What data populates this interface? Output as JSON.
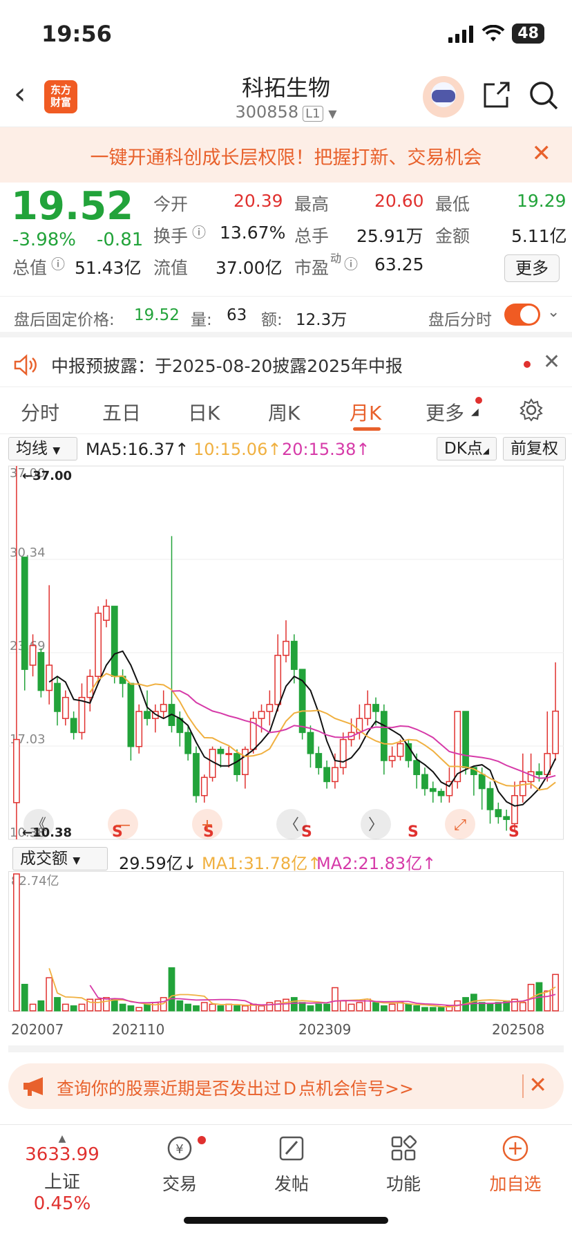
{
  "status": {
    "time": "19:56",
    "battery": "48"
  },
  "header": {
    "stock_name": "科拓生物",
    "stock_code": "300858",
    "level": "L1",
    "logo_text": "东方财富"
  },
  "promo": {
    "text": "一键开通科创成长层权限！把握打新、交易机会"
  },
  "quote": {
    "price": "19.52",
    "pct": "-3.98%",
    "change": "-0.81",
    "open_label": "今开",
    "open": "20.39",
    "high_label": "最高",
    "high": "20.60",
    "low_label": "最低",
    "low": "19.29",
    "turnover_label": "换手",
    "turnover": "13.67%",
    "volume_label": "总手",
    "volume": "25.91万",
    "amount_label": "金额",
    "amount": "5.11亿",
    "mktcap_label": "总值",
    "mktcap": "51.43亿",
    "float_label": "流值",
    "float": "37.00亿",
    "pe_label": "市盈",
    "pe_sup": "动",
    "pe": "63.25",
    "more": "更多"
  },
  "afterhours": {
    "label": "盘后固定价格:",
    "price": "19.52",
    "vol_label": "量:",
    "vol": "63",
    "amt_label": "额:",
    "amt": "12.3万",
    "toggle_label": "盘后分时"
  },
  "disclosure": {
    "text": "中报预披露：于2025-08-20披露2025年中报"
  },
  "tabs": [
    "分时",
    "五日",
    "日K",
    "周K",
    "月K",
    "更多"
  ],
  "active_tab": "月K",
  "ma_row": {
    "dropdown": "均线",
    "ma5": "MA5:16.37↑",
    "ma10": "10:15.06↑",
    "ma20": "20:15.38↑",
    "dk": "DK点",
    "adjust": "前复权"
  },
  "kline": {
    "y_labels": [
      "37.00",
      "30.34",
      "23.69",
      "17.03",
      "10.38"
    ],
    "max_label": "←37.00",
    "min_label": "←10.38",
    "signal_marks": [
      "S",
      "S",
      "S",
      "S",
      "S",
      "S"
    ],
    "nav_buttons": [
      "《",
      "—",
      "+",
      "〈",
      "〉",
      "⤢"
    ]
  },
  "vol_row": {
    "dropdown": "成交额",
    "value": "29.59亿↓",
    "ma1": "MA1:31.78亿↑",
    "ma2": "MA2:21.83亿↑"
  },
  "vol": {
    "top_label": "82.74亿",
    "x_labels": [
      "202007",
      "202110",
      "202309",
      "202508"
    ]
  },
  "chart_data": {
    "type": "candlestick",
    "period": "monthly",
    "ylim": [
      10.38,
      37.0
    ],
    "x_ticks": [
      "202007",
      "202110",
      "202309",
      "202508"
    ],
    "ma_series": [
      {
        "name": "MA5",
        "color": "#111111",
        "last": 16.37
      },
      {
        "name": "MA10",
        "color": "#f0b040",
        "last": 15.06
      },
      {
        "name": "MA20",
        "color": "#d63aa8",
        "last": 15.38
      }
    ],
    "candles": [
      [
        13.0,
        17.5,
        37.0,
        10.38
      ],
      [
        30.5,
        22.5,
        30.5,
        21.0
      ],
      [
        22.8,
        24.2,
        25.0,
        22.0
      ],
      [
        23.7,
        21.0,
        24.0,
        20.5
      ],
      [
        21.0,
        22.8,
        28.5,
        20.0
      ],
      [
        21.5,
        19.5,
        22.0,
        18.5
      ],
      [
        19.0,
        20.5,
        21.0,
        18.5
      ],
      [
        19.0,
        18.0,
        19.5,
        17.5
      ],
      [
        18.0,
        20.5,
        21.5,
        17.5
      ],
      [
        20.5,
        22.0,
        22.5,
        19.5
      ],
      [
        22.0,
        26.5,
        27.0,
        21.5
      ],
      [
        26.0,
        27.0,
        27.5,
        25.5
      ],
      [
        27.0,
        22.0,
        27.0,
        21.5
      ],
      [
        22.0,
        21.5,
        22.5,
        20.5
      ],
      [
        21.5,
        17.0,
        21.5,
        16.0
      ],
      [
        17.0,
        19.5,
        20.0,
        16.5
      ],
      [
        19.5,
        19.0,
        21.0,
        18.5
      ],
      [
        19.0,
        19.5,
        20.0,
        18.0
      ],
      [
        19.5,
        20.0,
        21.0,
        19.0
      ],
      [
        20.0,
        18.5,
        32.0,
        18.0
      ],
      [
        19.0,
        18.0,
        19.5,
        17.0
      ],
      [
        18.0,
        16.5,
        18.5,
        16.0
      ],
      [
        16.5,
        13.5,
        17.0,
        13.0
      ],
      [
        13.5,
        14.8,
        15.0,
        13.0
      ],
      [
        14.8,
        16.8,
        17.0,
        14.5
      ],
      [
        16.8,
        16.5,
        17.0,
        15.5
      ],
      [
        16.5,
        16.5,
        17.0,
        15.5
      ],
      [
        16.5,
        15.0,
        16.8,
        14.5
      ],
      [
        15.0,
        16.8,
        17.0,
        14.0
      ],
      [
        16.8,
        19.0,
        19.5,
        16.5
      ],
      [
        19.0,
        19.5,
        20.0,
        18.0
      ],
      [
        19.5,
        20.0,
        21.0,
        18.5
      ],
      [
        20.0,
        23.5,
        25.0,
        19.5
      ],
      [
        23.5,
        24.5,
        26.0,
        23.0
      ],
      [
        24.5,
        22.5,
        25.0,
        21.5
      ],
      [
        22.5,
        18.0,
        22.5,
        17.5
      ],
      [
        18.0,
        16.5,
        18.5,
        15.5
      ],
      [
        16.5,
        15.5,
        17.0,
        15.0
      ],
      [
        15.5,
        14.5,
        16.0,
        14.0
      ],
      [
        14.5,
        15.5,
        16.5,
        14.0
      ],
      [
        15.5,
        17.5,
        18.0,
        15.0
      ],
      [
        17.5,
        18.0,
        19.0,
        17.0
      ],
      [
        18.0,
        19.0,
        20.0,
        17.5
      ],
      [
        19.0,
        20.0,
        21.0,
        18.5
      ],
      [
        20.0,
        19.5,
        20.5,
        18.5
      ],
      [
        19.5,
        16.0,
        20.0,
        15.0
      ],
      [
        16.0,
        16.3,
        17.0,
        15.5
      ],
      [
        16.3,
        17.2,
        17.5,
        16.0
      ],
      [
        17.2,
        16.0,
        17.5,
        15.5
      ],
      [
        16.0,
        15.0,
        16.5,
        14.0
      ],
      [
        15.0,
        14.0,
        15.5,
        13.5
      ],
      [
        14.0,
        13.8,
        14.5,
        13.0
      ],
      [
        13.8,
        13.5,
        14.0,
        13.0
      ],
      [
        13.5,
        14.5,
        15.5,
        13.0
      ],
      [
        14.5,
        19.5,
        19.5,
        14.0
      ],
      [
        19.5,
        15.5,
        19.5,
        15.0
      ],
      [
        15.5,
        15.0,
        15.5,
        13.5
      ],
      [
        15.0,
        14.0,
        15.5,
        12.5
      ],
      [
        14.0,
        12.5,
        14.5,
        11.5
      ],
      [
        12.5,
        12.0,
        13.0,
        11.5
      ],
      [
        12.0,
        11.8,
        12.5,
        11.0
      ],
      [
        11.5,
        13.5,
        14.5,
        11.0
      ],
      [
        13.5,
        14.5,
        16.5,
        13.0
      ],
      [
        14.5,
        15.2,
        16.5,
        14.0
      ],
      [
        15.2,
        15.0,
        15.8,
        14.5
      ],
      [
        15.0,
        16.5,
        19.5,
        14.5
      ],
      [
        16.5,
        19.52,
        23.0,
        16.0
      ]
    ],
    "volume": [
      82.74,
      16,
      4,
      6,
      20,
      8,
      4,
      3,
      4,
      7,
      7,
      8,
      7,
      4,
      3,
      2,
      4,
      5,
      8,
      26,
      6,
      4,
      3,
      5,
      4,
      3,
      4,
      3,
      3,
      4,
      3,
      5,
      6,
      7,
      8,
      5,
      3,
      4,
      4,
      14,
      6,
      4,
      5,
      7,
      5,
      3,
      4,
      5,
      4,
      3,
      2,
      2,
      2,
      3,
      6,
      8,
      10,
      5,
      4,
      5,
      6,
      7,
      5,
      16,
      17,
      12,
      22,
      29.59
    ]
  }
}
